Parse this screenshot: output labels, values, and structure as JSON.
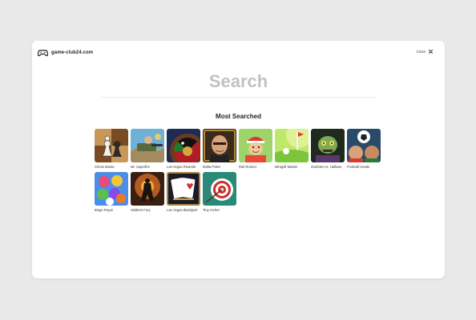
{
  "header": {
    "logo_icon": "gamepad-icon",
    "site_name": "game-club24.com",
    "close_label": "Close",
    "close_icon": "close-icon"
  },
  "search": {
    "placeholder": "Search"
  },
  "section": {
    "title": "Most Searched"
  },
  "games": [
    {
      "label": "Chess Mania"
    },
    {
      "label": "Mr. Superfire"
    },
    {
      "label": "Las Vegas Roulette"
    },
    {
      "label": "Mafia Poker"
    },
    {
      "label": "Rail Runner"
    },
    {
      "label": "Minigolf Master"
    },
    {
      "label": "Zombies vs. Hallowe"
    },
    {
      "label": "Football Heads"
    },
    {
      "label": "Bingo Royal"
    },
    {
      "label": "Soldiers Fury"
    },
    {
      "label": "Las Vegas Blackjack"
    },
    {
      "label": "Tiny Archer"
    }
  ]
}
